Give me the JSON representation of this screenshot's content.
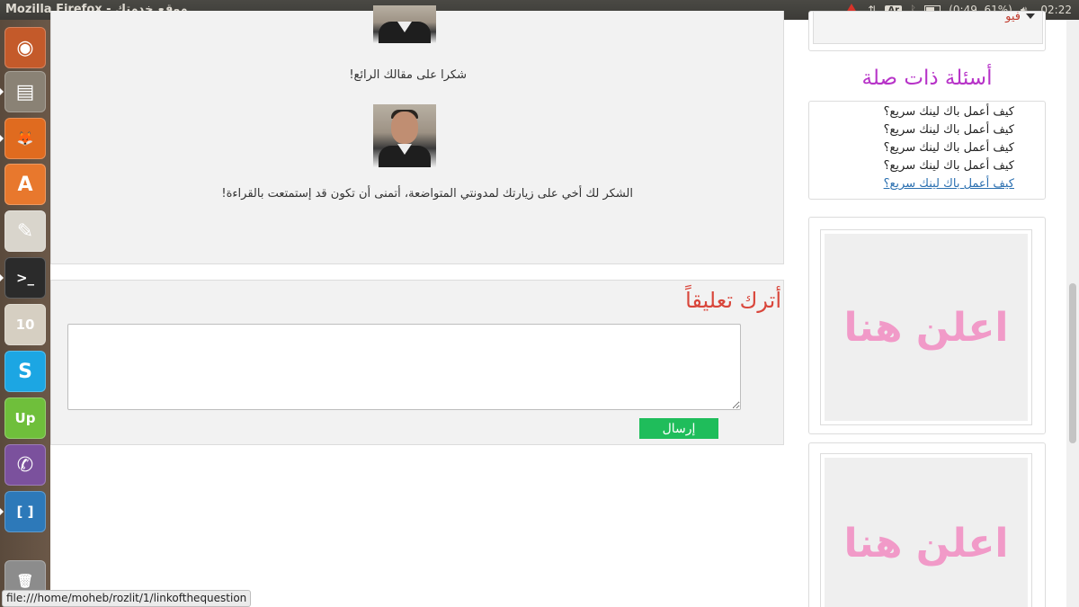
{
  "top_panel": {
    "window_title": "Mozilla Firefox - موقع خدمتك",
    "battery_text": "(0:49, 61%)",
    "keyboard_layout": "Ar",
    "clock": "02:22"
  },
  "launcher": {
    "items": [
      {
        "name": "ubuntu-dash",
        "glyph": "◉",
        "color": "#c45a2a"
      },
      {
        "name": "files",
        "glyph": "▤",
        "color": "#8a8275"
      },
      {
        "name": "firefox",
        "glyph": "🦊",
        "color": "#e06b1f"
      },
      {
        "name": "software-center",
        "glyph": "A",
        "color": "#e8782d"
      },
      {
        "name": "text-editor",
        "glyph": "✎",
        "color": "#d9d5cc"
      },
      {
        "name": "terminal",
        "glyph": ">_",
        "color": "#2b2b2b"
      },
      {
        "name": "calendar",
        "glyph": "10",
        "color": "#d6cfc2"
      },
      {
        "name": "skype",
        "glyph": "S",
        "color": "#1ca6e3"
      },
      {
        "name": "upwork",
        "glyph": "Up",
        "color": "#6fbf3b"
      },
      {
        "name": "viber",
        "glyph": "✆",
        "color": "#7b519d"
      },
      {
        "name": "brackets",
        "glyph": "[ ]",
        "color": "#2d79b9"
      },
      {
        "name": "trash",
        "glyph": "🗑",
        "color": "#8c8c8c"
      }
    ]
  },
  "comments": [
    {
      "text": "شكرا على مقالك الرائع!"
    },
    {
      "text": "الشكر لك أخي على زيارتك لمدونتي المتواضعة، أتمنى أن تكون قد إستمتعت بالقراءة!"
    }
  ],
  "leave_comment": {
    "title": "أترك تعليقاً",
    "textarea_value": "",
    "send_label": "إرسال"
  },
  "sidebar": {
    "top_dropdown_label": "فيو",
    "related_title": "أسئلة ذات صلة",
    "related_items": [
      "كيف أعمل باك لينك سريع؟",
      "كيف أعمل باك لينك سريع؟",
      "كيف أعمل باك لينك سريع؟",
      "كيف أعمل باك لينك سريع؟",
      "كيف أعمل باك لينك سريع؟"
    ],
    "ads": [
      {
        "label": "اعلن هنا"
      },
      {
        "label": "اعلن هنا"
      }
    ]
  },
  "status_bar_url": "file:///home/moheb/rozlit/1/linkofthequestion"
}
